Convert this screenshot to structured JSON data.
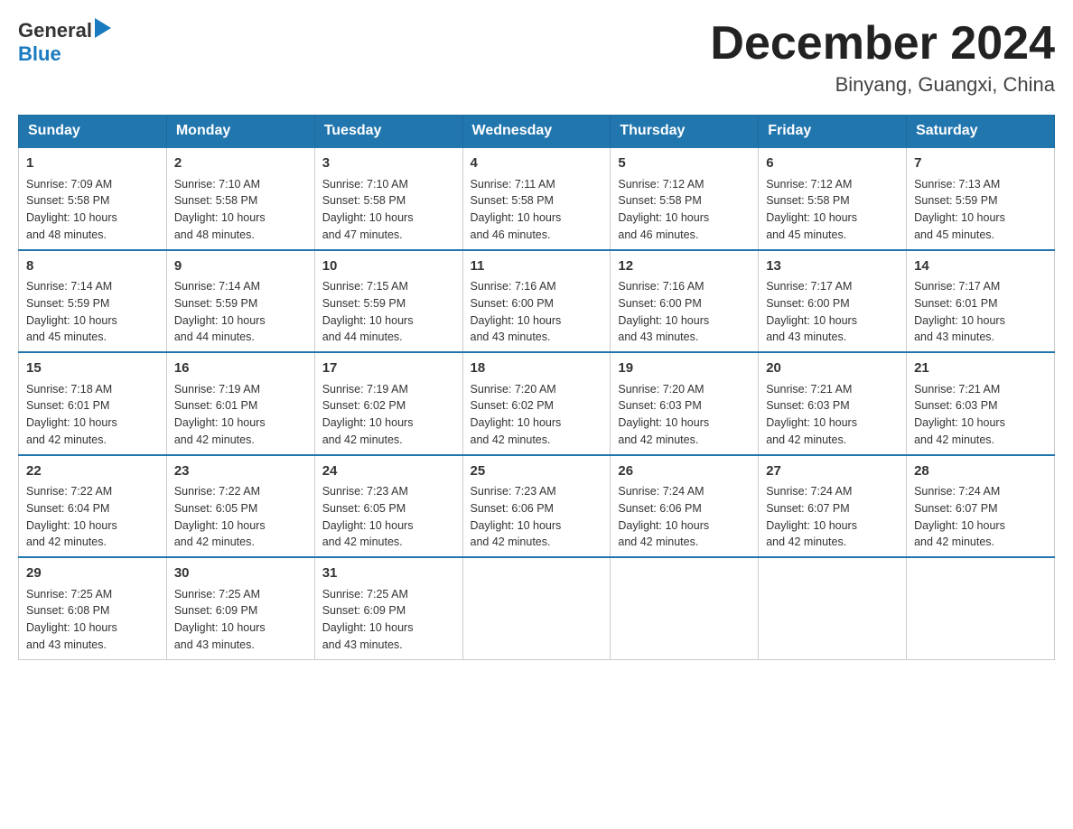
{
  "logo": {
    "text_general": "General",
    "text_blue": "Blue",
    "arrow_char": "▶"
  },
  "title": {
    "month_year": "December 2024",
    "location": "Binyang, Guangxi, China"
  },
  "days_of_week": [
    "Sunday",
    "Monday",
    "Tuesday",
    "Wednesday",
    "Thursday",
    "Friday",
    "Saturday"
  ],
  "weeks": [
    [
      {
        "day": "1",
        "info": "Sunrise: 7:09 AM\nSunset: 5:58 PM\nDaylight: 10 hours\nand 48 minutes."
      },
      {
        "day": "2",
        "info": "Sunrise: 7:10 AM\nSunset: 5:58 PM\nDaylight: 10 hours\nand 48 minutes."
      },
      {
        "day": "3",
        "info": "Sunrise: 7:10 AM\nSunset: 5:58 PM\nDaylight: 10 hours\nand 47 minutes."
      },
      {
        "day": "4",
        "info": "Sunrise: 7:11 AM\nSunset: 5:58 PM\nDaylight: 10 hours\nand 46 minutes."
      },
      {
        "day": "5",
        "info": "Sunrise: 7:12 AM\nSunset: 5:58 PM\nDaylight: 10 hours\nand 46 minutes."
      },
      {
        "day": "6",
        "info": "Sunrise: 7:12 AM\nSunset: 5:58 PM\nDaylight: 10 hours\nand 45 minutes."
      },
      {
        "day": "7",
        "info": "Sunrise: 7:13 AM\nSunset: 5:59 PM\nDaylight: 10 hours\nand 45 minutes."
      }
    ],
    [
      {
        "day": "8",
        "info": "Sunrise: 7:14 AM\nSunset: 5:59 PM\nDaylight: 10 hours\nand 45 minutes."
      },
      {
        "day": "9",
        "info": "Sunrise: 7:14 AM\nSunset: 5:59 PM\nDaylight: 10 hours\nand 44 minutes."
      },
      {
        "day": "10",
        "info": "Sunrise: 7:15 AM\nSunset: 5:59 PM\nDaylight: 10 hours\nand 44 minutes."
      },
      {
        "day": "11",
        "info": "Sunrise: 7:16 AM\nSunset: 6:00 PM\nDaylight: 10 hours\nand 43 minutes."
      },
      {
        "day": "12",
        "info": "Sunrise: 7:16 AM\nSunset: 6:00 PM\nDaylight: 10 hours\nand 43 minutes."
      },
      {
        "day": "13",
        "info": "Sunrise: 7:17 AM\nSunset: 6:00 PM\nDaylight: 10 hours\nand 43 minutes."
      },
      {
        "day": "14",
        "info": "Sunrise: 7:17 AM\nSunset: 6:01 PM\nDaylight: 10 hours\nand 43 minutes."
      }
    ],
    [
      {
        "day": "15",
        "info": "Sunrise: 7:18 AM\nSunset: 6:01 PM\nDaylight: 10 hours\nand 42 minutes."
      },
      {
        "day": "16",
        "info": "Sunrise: 7:19 AM\nSunset: 6:01 PM\nDaylight: 10 hours\nand 42 minutes."
      },
      {
        "day": "17",
        "info": "Sunrise: 7:19 AM\nSunset: 6:02 PM\nDaylight: 10 hours\nand 42 minutes."
      },
      {
        "day": "18",
        "info": "Sunrise: 7:20 AM\nSunset: 6:02 PM\nDaylight: 10 hours\nand 42 minutes."
      },
      {
        "day": "19",
        "info": "Sunrise: 7:20 AM\nSunset: 6:03 PM\nDaylight: 10 hours\nand 42 minutes."
      },
      {
        "day": "20",
        "info": "Sunrise: 7:21 AM\nSunset: 6:03 PM\nDaylight: 10 hours\nand 42 minutes."
      },
      {
        "day": "21",
        "info": "Sunrise: 7:21 AM\nSunset: 6:03 PM\nDaylight: 10 hours\nand 42 minutes."
      }
    ],
    [
      {
        "day": "22",
        "info": "Sunrise: 7:22 AM\nSunset: 6:04 PM\nDaylight: 10 hours\nand 42 minutes."
      },
      {
        "day": "23",
        "info": "Sunrise: 7:22 AM\nSunset: 6:05 PM\nDaylight: 10 hours\nand 42 minutes."
      },
      {
        "day": "24",
        "info": "Sunrise: 7:23 AM\nSunset: 6:05 PM\nDaylight: 10 hours\nand 42 minutes."
      },
      {
        "day": "25",
        "info": "Sunrise: 7:23 AM\nSunset: 6:06 PM\nDaylight: 10 hours\nand 42 minutes."
      },
      {
        "day": "26",
        "info": "Sunrise: 7:24 AM\nSunset: 6:06 PM\nDaylight: 10 hours\nand 42 minutes."
      },
      {
        "day": "27",
        "info": "Sunrise: 7:24 AM\nSunset: 6:07 PM\nDaylight: 10 hours\nand 42 minutes."
      },
      {
        "day": "28",
        "info": "Sunrise: 7:24 AM\nSunset: 6:07 PM\nDaylight: 10 hours\nand 42 minutes."
      }
    ],
    [
      {
        "day": "29",
        "info": "Sunrise: 7:25 AM\nSunset: 6:08 PM\nDaylight: 10 hours\nand 43 minutes."
      },
      {
        "day": "30",
        "info": "Sunrise: 7:25 AM\nSunset: 6:09 PM\nDaylight: 10 hours\nand 43 minutes."
      },
      {
        "day": "31",
        "info": "Sunrise: 7:25 AM\nSunset: 6:09 PM\nDaylight: 10 hours\nand 43 minutes."
      },
      null,
      null,
      null,
      null
    ]
  ]
}
